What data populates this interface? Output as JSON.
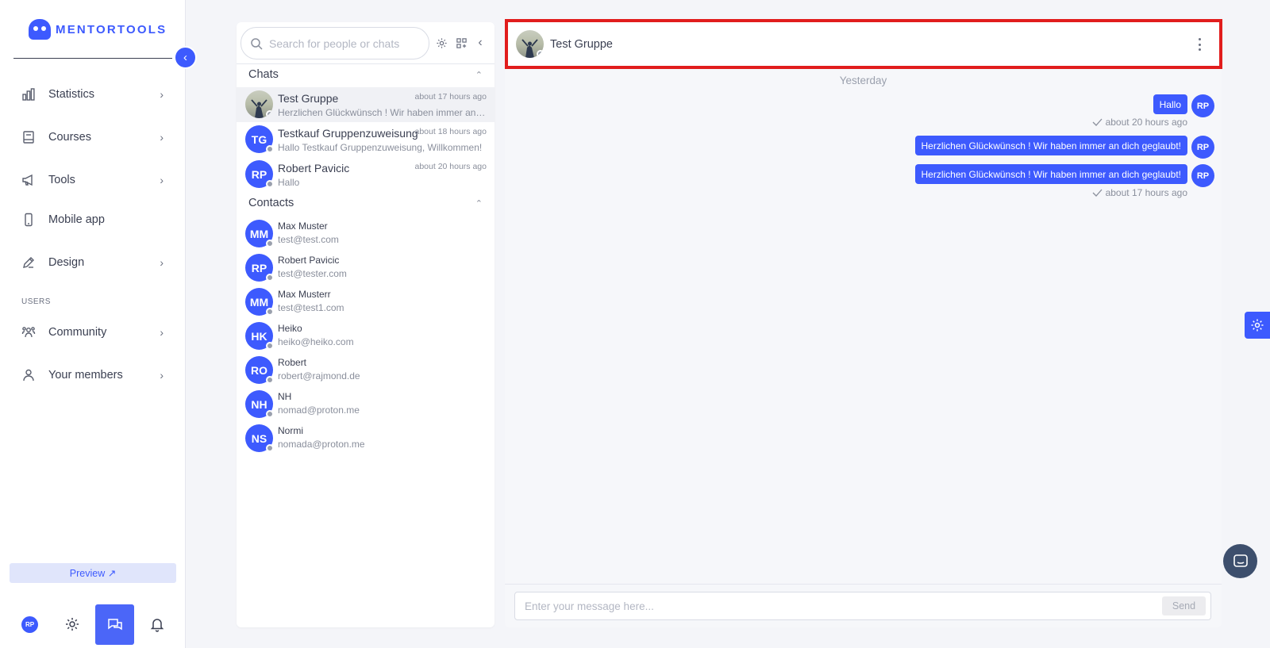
{
  "brand": {
    "name": "MENTORTOOLS"
  },
  "sidebar": {
    "items": [
      {
        "label": "Statistics",
        "icon": "bar-chart-icon"
      },
      {
        "label": "Courses",
        "icon": "book-icon"
      },
      {
        "label": "Tools",
        "icon": "megaphone-icon"
      },
      {
        "label": "Mobile app",
        "icon": "phone-icon"
      },
      {
        "label": "Design",
        "icon": "pencil-icon"
      }
    ],
    "section_users": "USERS",
    "user_items": [
      {
        "label": "Community",
        "icon": "group-icon"
      },
      {
        "label": "Your members",
        "icon": "user-icon"
      }
    ],
    "preview_label": "Preview ↗",
    "avatar_initials": "RP"
  },
  "chat_list": {
    "search_placeholder": "Search for people or chats",
    "chats_heading": "Chats",
    "contacts_heading": "Contacts",
    "chats": [
      {
        "name": "Test Gruppe",
        "time": "about 17 hours ago",
        "preview": "Herzlichen Glückwünsch ! Wir haben immer an dich geglaubt!",
        "initials": ""
      },
      {
        "name": "Testkauf Gruppenzuweisung",
        "time": "about 18 hours ago",
        "preview": "Hallo Testkauf Gruppenzuweisung, Willkommen!",
        "initials": "TG"
      },
      {
        "name": "Robert Pavicic",
        "time": "about 20 hours ago",
        "preview": "Hallo",
        "initials": "RP"
      }
    ],
    "contacts": [
      {
        "name": "Max Muster",
        "email": "test@test.com",
        "initials": "MM"
      },
      {
        "name": "Robert Pavicic",
        "email": "test@tester.com",
        "initials": "RP"
      },
      {
        "name": "Max Musterr",
        "email": "test@test1.com",
        "initials": "MM"
      },
      {
        "name": "Heiko",
        "email": "heiko@heiko.com",
        "initials": "HK"
      },
      {
        "name": "Robert",
        "email": "robert@rajmond.de",
        "initials": "RO"
      },
      {
        "name": "NH",
        "email": "nomad@proton.me",
        "initials": "NH"
      },
      {
        "name": "Normi",
        "email": "nomada@proton.me",
        "initials": "NS"
      }
    ]
  },
  "conversation": {
    "title": "Test Gruppe",
    "day_label": "Yesterday",
    "messages": [
      {
        "text": "Hallo",
        "initials": "RP",
        "time": "about 20 hours ago"
      },
      {
        "text": "Herzlichen Glückwünsch ! Wir haben immer an dich geglaubt!",
        "initials": "RP",
        "time": ""
      },
      {
        "text": "Herzlichen Glückwünsch ! Wir haben immer an dich geglaubt!",
        "initials": "RP",
        "time": "about 17 hours ago"
      }
    ],
    "composer_placeholder": "Enter your message here...",
    "send_label": "Send"
  },
  "colors": {
    "accent": "#3d5afe",
    "highlight": "#e11d1d"
  }
}
